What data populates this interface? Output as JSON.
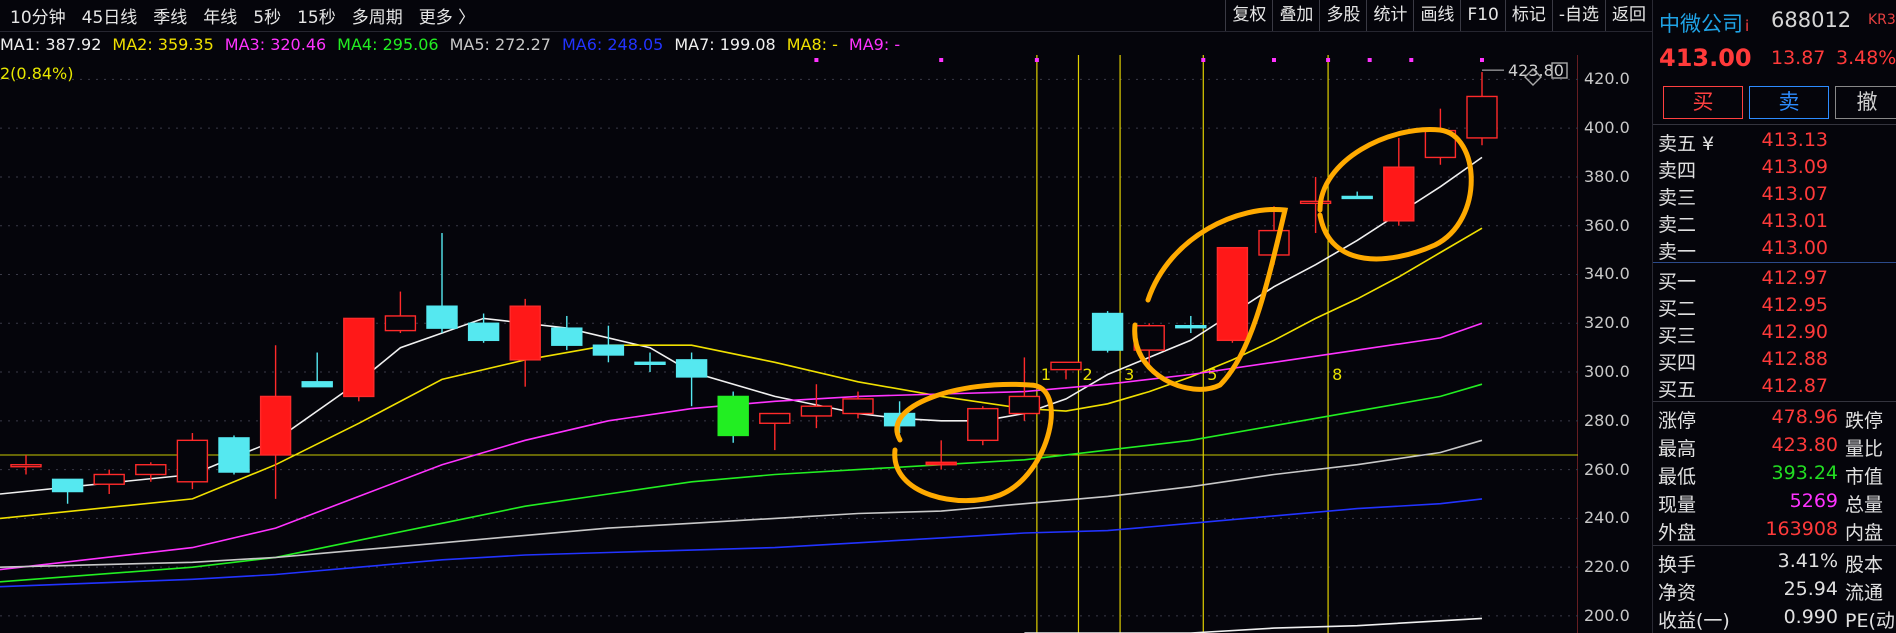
{
  "toolbar": {
    "periods": [
      "10分钟",
      "45日线",
      "季线",
      "年线",
      "5秒",
      "15秒",
      "多周期",
      "更多 〉"
    ],
    "tools": [
      "复权",
      "叠加",
      "多股",
      "统计",
      "画线",
      "F10",
      "标记",
      "-自选",
      "返回"
    ]
  },
  "ma_legend": [
    {
      "label": "MA1: 387.92",
      "color": "#f0f0f0"
    },
    {
      "label": "MA2: 359.35",
      "color": "#f0e000"
    },
    {
      "label": "MA3: 320.46",
      "color": "#ff33ff"
    },
    {
      "label": "MA4: 295.06",
      "color": "#22ee22"
    },
    {
      "label": "MA5: 272.27",
      "color": "#c8c8c8"
    },
    {
      "label": "MA6: 248.05",
      "color": "#2233ff"
    },
    {
      "label": "MA7: 199.08",
      "color": "#f0f0f0"
    },
    {
      "label": "MA8: -",
      "color": "#f0e000"
    },
    {
      "label": "MA9: -",
      "color": "#ff33ff"
    }
  ],
  "sub_legend": "2(0.84%)",
  "chart_data": {
    "type": "candlestick",
    "y_ticks": [
      "420.0",
      "400.0",
      "380.0",
      "360.0",
      "340.0",
      "320.0",
      "300.0",
      "280.0",
      "260.0",
      "240.0",
      "220.0",
      "200.0"
    ],
    "ylim": [
      193,
      430
    ],
    "high_annotation": "423.80",
    "reference_level": 266,
    "candles": [
      {
        "o": 262,
        "h": 266,
        "l": 258,
        "c": 262,
        "u": true
      },
      {
        "o": 251,
        "h": 256,
        "l": 246,
        "c": 256,
        "u": false
      },
      {
        "o": 254,
        "h": 260,
        "l": 250,
        "c": 258,
        "u": true
      },
      {
        "o": 258,
        "h": 263,
        "l": 255,
        "c": 262,
        "u": true
      },
      {
        "o": 255,
        "h": 275,
        "l": 252,
        "c": 272,
        "u": true
      },
      {
        "o": 259,
        "h": 274,
        "l": 258,
        "c": 273,
        "u": false
      },
      {
        "o": 266,
        "h": 311,
        "l": 248,
        "c": 290,
        "u": true
      },
      {
        "o": 296,
        "h": 308,
        "l": 294,
        "c": 294,
        "u": false
      },
      {
        "o": 290,
        "h": 322,
        "l": 288,
        "c": 322,
        "u": true
      },
      {
        "o": 323,
        "h": 333,
        "l": 316,
        "c": 317,
        "u": true
      },
      {
        "o": 327,
        "h": 357,
        "l": 316,
        "c": 318,
        "u": false
      },
      {
        "o": 320,
        "h": 324,
        "l": 312,
        "c": 313,
        "u": false
      },
      {
        "o": 305,
        "h": 330,
        "l": 294,
        "c": 327,
        "u": true
      },
      {
        "o": 318,
        "h": 323,
        "l": 309,
        "c": 311,
        "u": false
      },
      {
        "o": 311,
        "h": 319,
        "l": 304,
        "c": 307,
        "u": false
      },
      {
        "o": 304,
        "h": 308,
        "l": 300,
        "c": 304,
        "u": false
      },
      {
        "o": 305,
        "h": 308,
        "l": 286,
        "c": 298,
        "u": false
      },
      {
        "o": 290,
        "h": 292,
        "l": 271,
        "c": 274,
        "u": false
      },
      {
        "o": 279,
        "h": 282,
        "l": 268,
        "c": 283,
        "u": true
      },
      {
        "o": 282,
        "h": 295,
        "l": 277,
        "c": 286,
        "u": true
      },
      {
        "o": 283,
        "h": 292,
        "l": 281,
        "c": 289,
        "u": true
      },
      {
        "o": 283,
        "h": 288,
        "l": 275,
        "c": 278,
        "u": false
      },
      {
        "o": 262,
        "h": 272,
        "l": 260,
        "c": 263,
        "u": true
      },
      {
        "o": 272,
        "h": 286,
        "l": 270,
        "c": 285,
        "u": true
      },
      {
        "o": 283,
        "h": 306,
        "l": 280,
        "c": 290,
        "u": true
      },
      {
        "o": 301,
        "h": 304,
        "l": 297,
        "c": 304,
        "u": true
      },
      {
        "o": 324,
        "h": 325,
        "l": 308,
        "c": 309,
        "u": false
      },
      {
        "o": 309,
        "h": 320,
        "l": 301,
        "c": 319,
        "u": true
      },
      {
        "o": 319,
        "h": 323,
        "l": 316,
        "c": 319,
        "u": false
      },
      {
        "o": 313,
        "h": 351,
        "l": 312,
        "c": 351,
        "u": true
      },
      {
        "o": 348,
        "h": 368,
        "l": 344,
        "c": 358,
        "u": true
      },
      {
        "o": 370,
        "h": 380,
        "l": 357,
        "c": 370,
        "u": true
      },
      {
        "o": 372,
        "h": 374,
        "l": 371,
        "c": 372,
        "u": false
      },
      {
        "o": 362,
        "h": 396,
        "l": 360,
        "c": 384,
        "u": true
      },
      {
        "o": 388,
        "h": 408,
        "l": 385,
        "c": 399,
        "u": true
      },
      {
        "o": 396,
        "h": 423,
        "l": 393,
        "c": 413,
        "u": true
      }
    ],
    "ma_series": [
      {
        "name": "MA1",
        "color": "#f0f0f0",
        "points": [
          [
            0,
            250
          ],
          [
            4,
            258
          ],
          [
            6,
            272
          ],
          [
            8,
            296
          ],
          [
            9,
            310
          ],
          [
            11,
            322
          ],
          [
            13,
            318
          ],
          [
            15,
            310
          ],
          [
            16,
            300
          ],
          [
            18,
            290
          ],
          [
            20,
            283
          ],
          [
            21,
            281
          ],
          [
            22,
            280
          ],
          [
            23,
            280
          ],
          [
            24,
            283
          ],
          [
            25,
            289
          ],
          [
            26,
            299
          ],
          [
            27,
            306
          ],
          [
            28,
            313
          ],
          [
            29,
            324
          ],
          [
            30,
            335
          ],
          [
            31,
            344
          ],
          [
            32,
            354
          ],
          [
            33,
            365
          ],
          [
            34,
            376
          ],
          [
            35,
            388
          ]
        ]
      },
      {
        "name": "MA2",
        "color": "#f0e000",
        "points": [
          [
            0,
            240
          ],
          [
            4,
            248
          ],
          [
            6,
            262
          ],
          [
            8,
            279
          ],
          [
            10,
            297
          ],
          [
            12,
            305
          ],
          [
            14,
            311
          ],
          [
            16,
            311
          ],
          [
            18,
            304
          ],
          [
            20,
            296
          ],
          [
            22,
            290
          ],
          [
            24,
            285
          ],
          [
            25,
            284
          ],
          [
            26,
            287
          ],
          [
            27,
            292
          ],
          [
            28,
            298
          ],
          [
            29,
            305
          ],
          [
            30,
            313
          ],
          [
            31,
            322
          ],
          [
            32,
            330
          ],
          [
            33,
            339
          ],
          [
            34,
            349
          ],
          [
            35,
            359
          ]
        ]
      },
      {
        "name": "MA3",
        "color": "#ff33ff",
        "points": [
          [
            0,
            219
          ],
          [
            4,
            228
          ],
          [
            6,
            236
          ],
          [
            8,
            249
          ],
          [
            10,
            262
          ],
          [
            12,
            272
          ],
          [
            14,
            280
          ],
          [
            16,
            285
          ],
          [
            18,
            288
          ],
          [
            20,
            290
          ],
          [
            22,
            291
          ],
          [
            24,
            292
          ],
          [
            26,
            295
          ],
          [
            28,
            299
          ],
          [
            30,
            304
          ],
          [
            32,
            309
          ],
          [
            34,
            314
          ],
          [
            35,
            320
          ]
        ]
      },
      {
        "name": "MA4",
        "color": "#22ee22",
        "points": [
          [
            0,
            214
          ],
          [
            4,
            220
          ],
          [
            6,
            224
          ],
          [
            8,
            231
          ],
          [
            10,
            238
          ],
          [
            12,
            245
          ],
          [
            14,
            250
          ],
          [
            16,
            255
          ],
          [
            18,
            258
          ],
          [
            20,
            260
          ],
          [
            22,
            262
          ],
          [
            24,
            264
          ],
          [
            26,
            268
          ],
          [
            28,
            272
          ],
          [
            30,
            278
          ],
          [
            32,
            284
          ],
          [
            34,
            290
          ],
          [
            35,
            295
          ]
        ]
      },
      {
        "name": "MA5",
        "color": "#c8c8c8",
        "points": [
          [
            0,
            220
          ],
          [
            4,
            222
          ],
          [
            6,
            224
          ],
          [
            8,
            227
          ],
          [
            10,
            230
          ],
          [
            12,
            233
          ],
          [
            14,
            236
          ],
          [
            16,
            238
          ],
          [
            18,
            240
          ],
          [
            20,
            242
          ],
          [
            22,
            243
          ],
          [
            24,
            246
          ],
          [
            26,
            249
          ],
          [
            28,
            253
          ],
          [
            30,
            258
          ],
          [
            32,
            262
          ],
          [
            34,
            267
          ],
          [
            35,
            272
          ]
        ]
      },
      {
        "name": "MA6",
        "color": "#2233ff",
        "points": [
          [
            0,
            212
          ],
          [
            4,
            215
          ],
          [
            6,
            217
          ],
          [
            8,
            220
          ],
          [
            10,
            223
          ],
          [
            12,
            225
          ],
          [
            14,
            226
          ],
          [
            16,
            227
          ],
          [
            18,
            228
          ],
          [
            20,
            230
          ],
          [
            22,
            232
          ],
          [
            24,
            234
          ],
          [
            26,
            235
          ],
          [
            28,
            238
          ],
          [
            30,
            241
          ],
          [
            32,
            244
          ],
          [
            34,
            246
          ],
          [
            35,
            248
          ]
        ]
      },
      {
        "name": "MA7",
        "color": "#f0f0f0",
        "points": [
          [
            24,
            193
          ],
          [
            28,
            193
          ],
          [
            30,
            195
          ],
          [
            32,
            196
          ],
          [
            34,
            198
          ],
          [
            35,
            199
          ]
        ]
      }
    ],
    "markers": [
      {
        "label": "1",
        "i": 24.3
      },
      {
        "label": "2",
        "i": 25.3
      },
      {
        "label": "3",
        "i": 26.3
      },
      {
        "label": "5",
        "i": 28.3
      },
      {
        "label": "8",
        "i": 31.3
      }
    ]
  },
  "panel": {
    "name": "中微公司",
    "name_suffix": "i",
    "code": "688012",
    "tag": "KR3",
    "price": "413.00",
    "change": "13.87",
    "change_pct": "3.48%",
    "buttons": [
      "买",
      "卖",
      "撤"
    ],
    "asks": [
      {
        "label": "卖五 ¥",
        "value": "413.13"
      },
      {
        "label": "卖四",
        "value": "413.09"
      },
      {
        "label": "卖三",
        "value": "413.07"
      },
      {
        "label": "卖二",
        "value": "413.01"
      },
      {
        "label": "卖一",
        "value": "413.00"
      }
    ],
    "bids": [
      {
        "label": "买一",
        "value": "412.97"
      },
      {
        "label": "买二",
        "value": "412.95"
      },
      {
        "label": "买三",
        "value": "412.90"
      },
      {
        "label": "买四",
        "value": "412.88"
      },
      {
        "label": "买五",
        "value": "412.87"
      }
    ],
    "stats": [
      {
        "l1": "涨停",
        "v1": "478.96",
        "c": "#ff3a3a",
        "l2": "跌停"
      },
      {
        "l1": "最高",
        "v1": "423.80",
        "c": "#ff3a3a",
        "l2": "量比"
      },
      {
        "l1": "最低",
        "v1": "393.24",
        "c": "#22dd22",
        "l2": "市值"
      },
      {
        "l1": "现量",
        "v1": "5269",
        "c": "#ff33ff",
        "l2": "总量"
      },
      {
        "l1": "外盘",
        "v1": "163908",
        "c": "#ff3a3a",
        "l2": "内盘"
      }
    ],
    "stats2": [
      {
        "l1": "换手",
        "v1": "3.41%",
        "c": "#e0e0e0",
        "l2": "股本"
      },
      {
        "l1": "净资",
        "v1": "25.94",
        "c": "#e0e0e0",
        "l2": "流通"
      },
      {
        "l1": "收益(一)",
        "v1": "0.990",
        "c": "#e0e0e0",
        "l2": "PE(动)"
      }
    ]
  }
}
